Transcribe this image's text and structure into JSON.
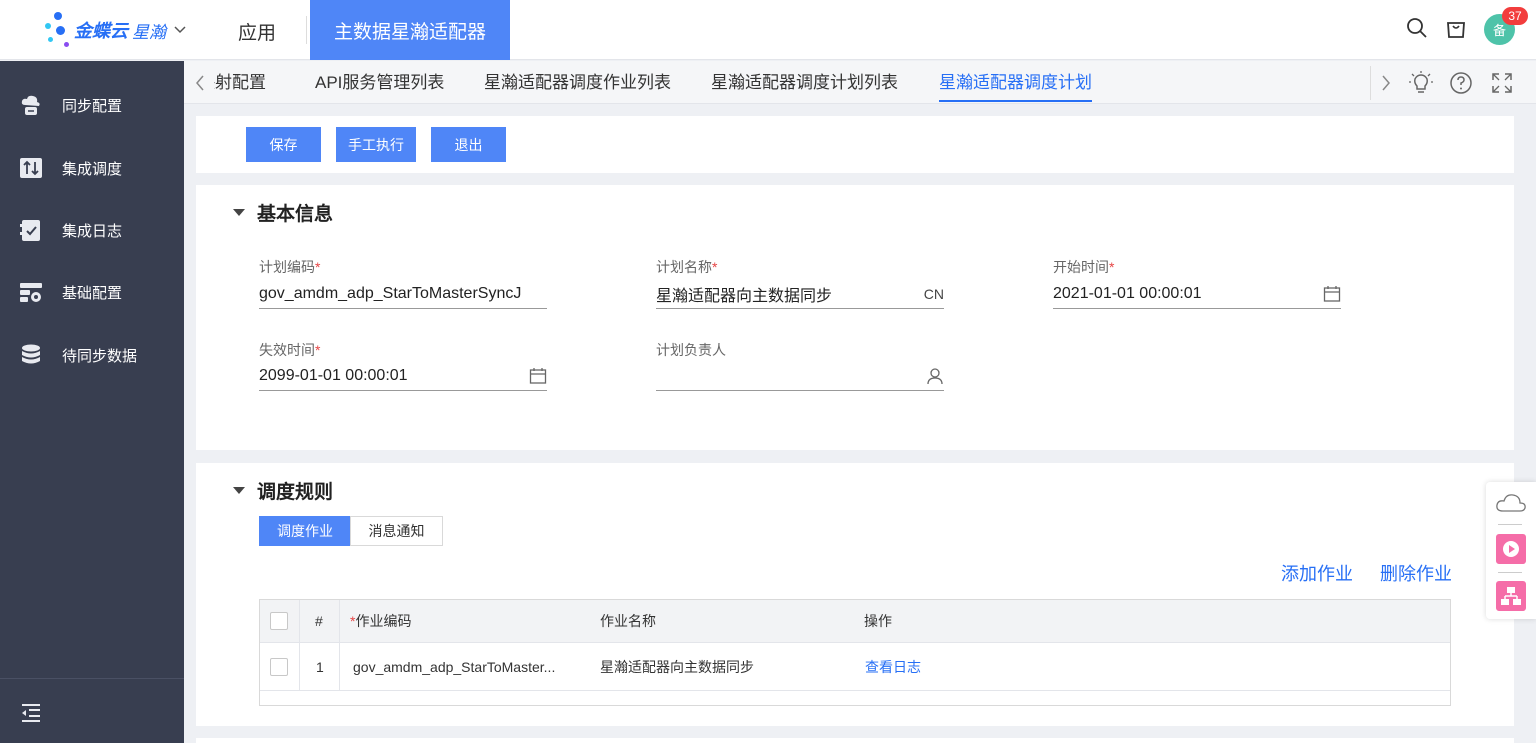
{
  "header": {
    "brand": "金蝶云",
    "brand_sub": "星瀚",
    "nav_app": "应用",
    "nav_active": "主数据星瀚适配器",
    "avatar_text": "备",
    "badge_count": "37"
  },
  "sidebar": {
    "items": [
      {
        "label": "同步配置",
        "icon": "cloud-sync-icon"
      },
      {
        "label": "集成调度",
        "icon": "transfer-icon"
      },
      {
        "label": "集成日志",
        "icon": "checklist-icon"
      },
      {
        "label": "基础配置",
        "icon": "config-icon"
      },
      {
        "label": "待同步数据",
        "icon": "database-icon"
      }
    ],
    "collapse_icon": "collapse-menu-icon"
  },
  "tabs": {
    "items": [
      {
        "label": "映射配置"
      },
      {
        "label": "API服务管理列表"
      },
      {
        "label": "星瀚适配器调度作业列表"
      },
      {
        "label": "星瀚适配器调度计划列表"
      },
      {
        "label": "星瀚适配器调度计划"
      }
    ],
    "active_index": 4
  },
  "toolbar": {
    "save": "保存",
    "manual_run": "手工执行",
    "exit": "退出"
  },
  "basic_info": {
    "title": "基本信息",
    "fields": {
      "plan_code": {
        "label": "计划编码",
        "value": "gov_amdm_adp_StarToMasterSyncJ"
      },
      "plan_name": {
        "label": "计划名称",
        "value": "星瀚适配器向主数据同步",
        "suffix": "CN"
      },
      "start_time": {
        "label": "开始时间",
        "value": "2021-01-01 00:00:01"
      },
      "expire_time": {
        "label": "失效时间",
        "value": "2099-01-01 00:00:01"
      },
      "owner": {
        "label": "计划负责人",
        "value": ""
      }
    },
    "required_mark": "*"
  },
  "schedule_rules": {
    "title": "调度规则",
    "segments": [
      "调度作业",
      "消息通知"
    ],
    "active_segment": 0,
    "add_job": "添加作业",
    "delete_job": "删除作业",
    "table": {
      "headers": {
        "index": "#",
        "job_code": "作业编码",
        "job_name": "作业名称",
        "action": "操作"
      },
      "rows": [
        {
          "index": "1",
          "job_code": "gov_amdm_adp_StarToMaster...",
          "job_name": "星瀚适配器向主数据同步",
          "action": "查看日志"
        }
      ]
    }
  },
  "colors": {
    "primary": "#4f86f7",
    "link": "#276ff5",
    "sidebar_bg": "#383e50",
    "required": "#e64545"
  }
}
